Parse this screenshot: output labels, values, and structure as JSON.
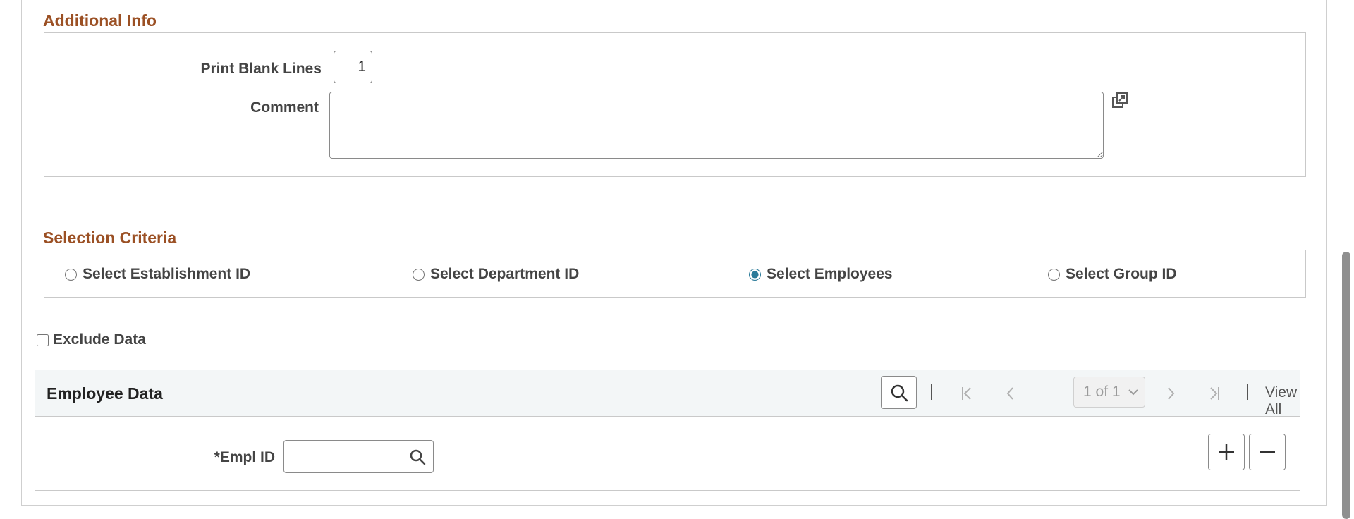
{
  "additional_info": {
    "title": "Additional Info",
    "print_blank_lines_label": "Print Blank Lines",
    "print_blank_lines_value": "1",
    "comment_label": "Comment",
    "comment_value": ""
  },
  "selection_criteria": {
    "title": "Selection Criteria",
    "options": [
      {
        "label": "Select Establishment ID",
        "selected": false
      },
      {
        "label": "Select Department ID",
        "selected": false
      },
      {
        "label": "Select Employees",
        "selected": true
      },
      {
        "label": "Select Group ID",
        "selected": false
      }
    ]
  },
  "exclude_data": {
    "label": "Exclude Data",
    "checked": false
  },
  "employee_grid": {
    "title": "Employee Data",
    "page_indicator": "1 of 1",
    "view_all_label": "View All",
    "empl_id_label": "*Empl ID",
    "empl_id_value": ""
  },
  "colors": {
    "section_title": "#9b5024",
    "radio_accent": "#2a7a99"
  },
  "icons": [
    "expand-icon",
    "search-icon",
    "first-page-icon",
    "previous-icon",
    "chevron-down-icon",
    "next-icon",
    "last-page-icon",
    "add-row-icon",
    "delete-row-icon"
  ]
}
